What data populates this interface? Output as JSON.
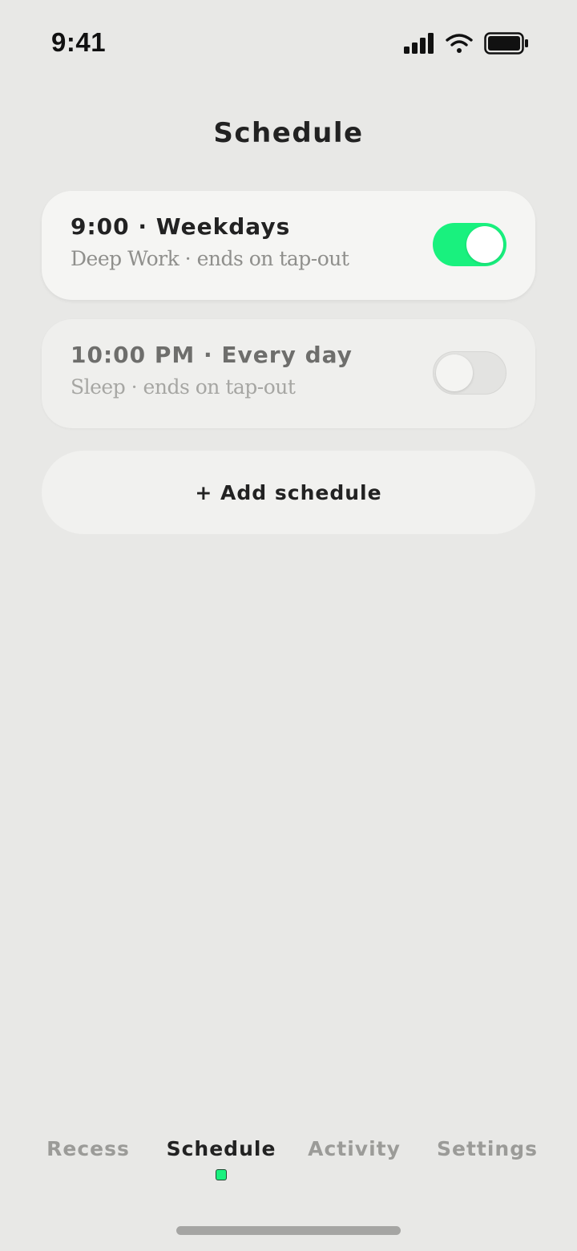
{
  "status_bar": {
    "time": "9:41",
    "icons": [
      "signal-icon",
      "wifi-icon",
      "battery-icon"
    ]
  },
  "page": {
    "title": "Schedule"
  },
  "schedules": [
    {
      "title": "9:00 · Weekdays",
      "subtitle": "Deep Work · ends on tap-out",
      "enabled": true
    },
    {
      "title": "10:00 PM · Every day",
      "subtitle": "Sleep · ends on tap-out",
      "enabled": false
    }
  ],
  "add_button": {
    "label": "+ Add schedule"
  },
  "tabs": [
    {
      "label": "Recess",
      "active": false
    },
    {
      "label": "Schedule",
      "active": true
    },
    {
      "label": "Activity",
      "active": false
    },
    {
      "label": "Settings",
      "active": false
    }
  ],
  "colors": {
    "background": "#e8e8e6",
    "accent": "#19f17e",
    "text_primary": "#222222",
    "text_muted": "#9b9b98"
  }
}
